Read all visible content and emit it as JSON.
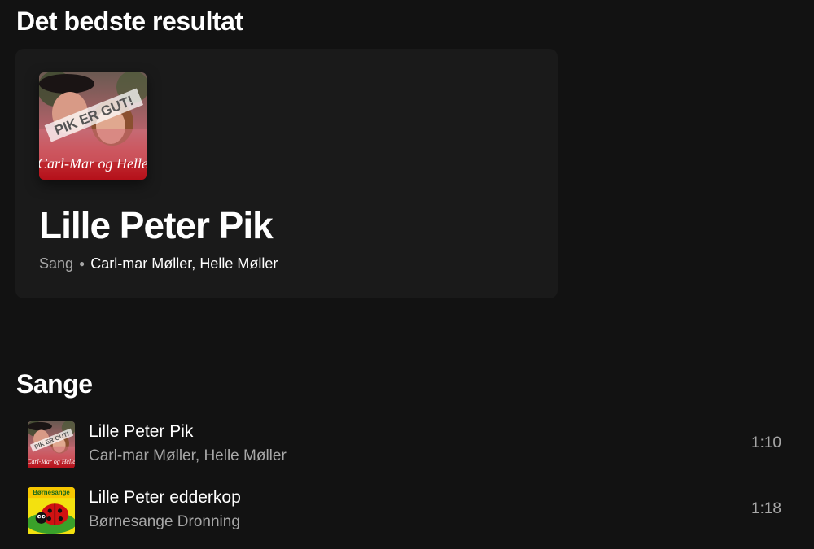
{
  "top_result": {
    "section_title": "Det bedste resultat",
    "cover": {
      "icon": "album-cover-carl-mar-og-helle",
      "stamp_text": "PIK ER GUT!",
      "caption": "Carl-Mar og Helle"
    },
    "title": "Lille Peter Pik",
    "type": "Sang",
    "artists": [
      "Carl-mar Møller",
      "Helle Møller"
    ],
    "artist_separator": ", "
  },
  "songs": {
    "section_title": "Sange",
    "items": [
      {
        "title": "Lille Peter Pik",
        "artist": "Carl-mar Møller, Helle Møller",
        "duration": "1:10",
        "cover": {
          "icon": "album-cover-carl-mar-og-helle",
          "stamp_text": "PIK ER GUT!",
          "caption": "Carl-Mar og Helle"
        }
      },
      {
        "title": "Lille Peter edderkop",
        "artist": "Børnesange Dronning",
        "duration": "1:18",
        "cover": {
          "icon": "album-cover-ladybug",
          "caption": "Børnesange"
        }
      }
    ]
  },
  "colors": {
    "background": "#121212",
    "card": "#1a1a1a",
    "text_primary": "#ffffff",
    "text_secondary": "#a7a7a7"
  }
}
